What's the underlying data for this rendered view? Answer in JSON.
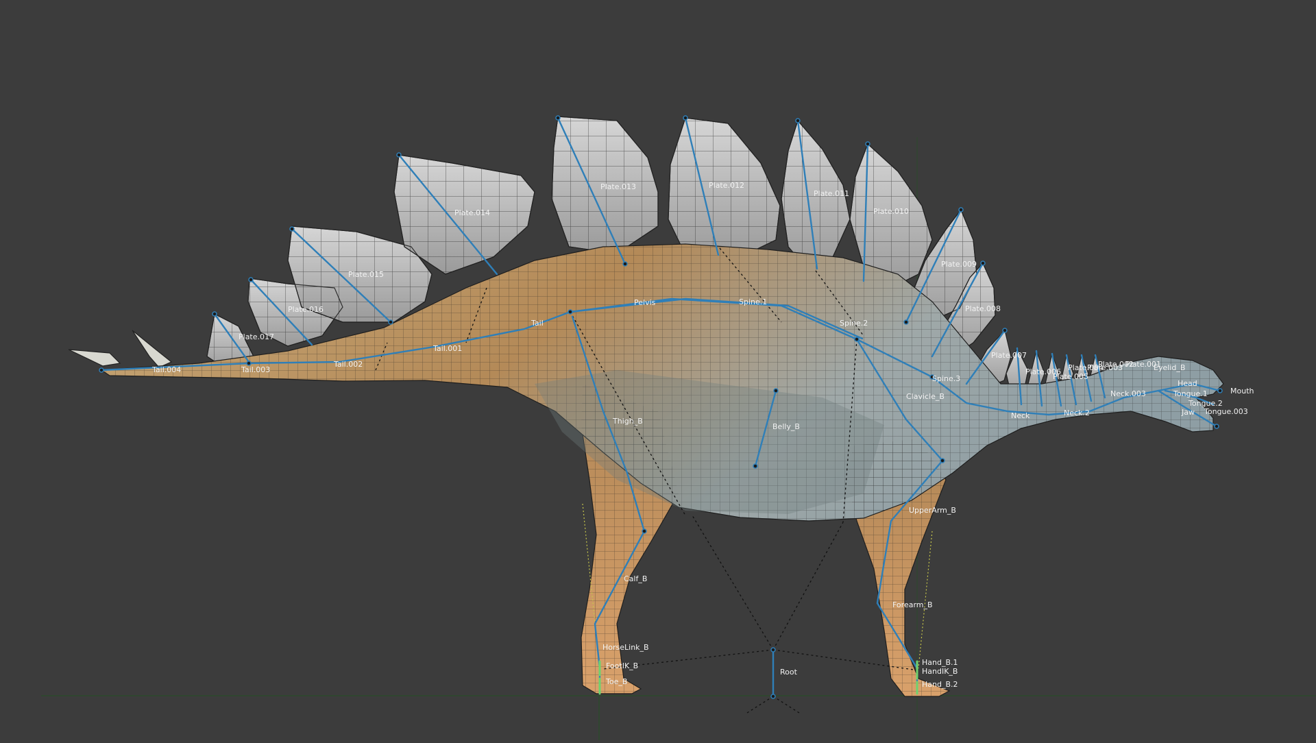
{
  "viewport": {
    "background": "#3c3c3c",
    "grid_color": "#2c4a2c",
    "bone_color": "#2f7fb8",
    "skin_tone": "#c79a63",
    "plate_color": "#bfbfbf",
    "accent_green": "#6fd26f"
  },
  "bone_labels": {
    "tail_004": "Tail.004",
    "tail_003": "Tail.003",
    "tail_002": "Tail.002",
    "tail_001": "Tail.001",
    "tail": "Tail",
    "pelvis": "Pelvis",
    "spine_1": "Spine.1",
    "spine_2": "Spine.2",
    "spine_3": "Spine.3",
    "clavicle": "Clavicle_B",
    "neck": "Neck",
    "neck_2": "Neck.2",
    "neck_003": "Neck.003",
    "plate_017": "Plate.017",
    "plate_016": "Plate.016",
    "plate_015": "Plate.015",
    "plate_014": "Plate.014",
    "plate_013": "Plate.013",
    "plate_012": "Plate.012",
    "plate_011": "Plate.011",
    "plate_010": "Plate.010",
    "plate_009": "Plate.009",
    "plate_008": "Plate.008",
    "plate_007": "Plate.007",
    "plate_006": "Plate.006",
    "plate_005": "Plate.005",
    "plate_004": "Plate.004",
    "plate_003": "Plate.003",
    "plate_002": "Plate.002",
    "plate_001": "Plate.001",
    "head": "Head",
    "eyelid": "Eyelid_B",
    "mouth": "Mouth",
    "tongue_1": "Tongue.1",
    "tongue_2": "Tongue.2",
    "tongue_003": "Tongue.003",
    "jaw": "Jaw",
    "thigh": "Thigh_B",
    "belly": "Belly_B",
    "calf": "Calf_B",
    "horselink": "HorseLink_B",
    "footik": "FootIK_B",
    "toe": "Toe_B",
    "root": "Root",
    "upperarm": "UpperArm_B",
    "forearm": "Forearm_B",
    "hand_1": "Hand_B.1",
    "handik": "HandIK_B",
    "hand_2": "Hand_B.2"
  }
}
